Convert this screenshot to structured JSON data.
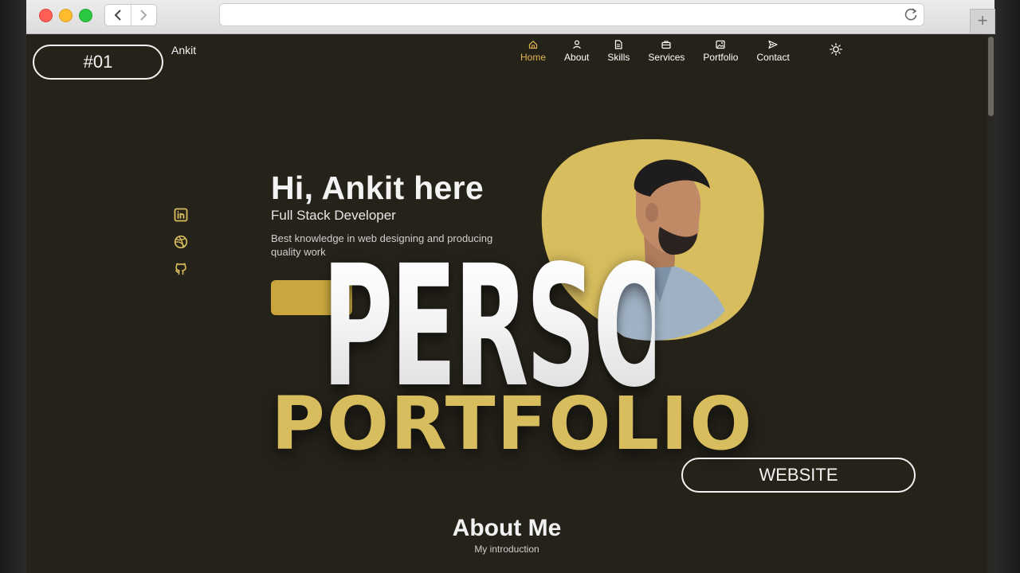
{
  "browser": {
    "back_icon": "chevron-left-icon",
    "forward_icon": "chevron-right-icon",
    "reload_icon": "reload-icon",
    "new_tab_label": "+"
  },
  "site": {
    "brand": "Ankit",
    "nav": [
      {
        "label": "Home",
        "icon": "home-icon",
        "active": true
      },
      {
        "label": "About",
        "icon": "user-icon",
        "active": false
      },
      {
        "label": "Skills",
        "icon": "file-icon",
        "active": false
      },
      {
        "label": "Services",
        "icon": "briefcase-icon",
        "active": false
      },
      {
        "label": "Portfolio",
        "icon": "image-icon",
        "active": false
      },
      {
        "label": "Contact",
        "icon": "send-icon",
        "active": false
      }
    ],
    "theme_icon": "sun-icon",
    "social": [
      "linkedin-icon",
      "dribbble-icon",
      "github-icon"
    ],
    "hero": {
      "title": "Hi, Ankit here",
      "role": "Full Stack Developer",
      "description": "Best knowledge in web designing and producing quality work"
    },
    "about": {
      "title": "About Me",
      "subtitle": "My introduction"
    }
  },
  "overlay": {
    "episode": "#01",
    "headline_1": "PERSONAL",
    "headline_2": "PORTFOLIO",
    "tag": "WEBSITE"
  },
  "colors": {
    "background": "#25221a",
    "accent": "#d8bd5e",
    "active_nav": "#e0b64f",
    "text": "#f3f3f3"
  }
}
